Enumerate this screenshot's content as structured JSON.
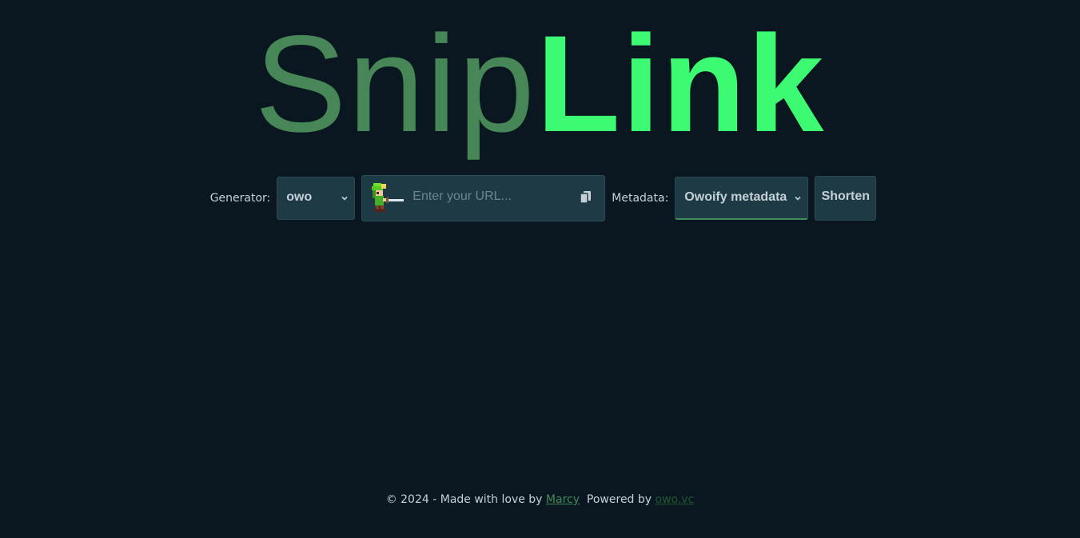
{
  "logo": {
    "part1": "Snip",
    "part2": "Link"
  },
  "generator": {
    "label": "Generator:",
    "value": "owo"
  },
  "url": {
    "placeholder": "Enter your URL..."
  },
  "metadata": {
    "label": "Metadata:",
    "value": "Owoify metadata"
  },
  "shorten_label": "Shorten",
  "footer": {
    "prefix": "© 2024 - Made with love by ",
    "author": "Marcy",
    "powered": "Powered by ",
    "service": "owo.vc"
  },
  "icons": {
    "generator_chevron": "chevron-down-icon",
    "metadata_chevron": "chevron-down-icon",
    "paste": "clipboard-paste-icon",
    "mascot": "pixel-swordsman-icon"
  },
  "colors": {
    "background": "#0a1720",
    "logo_snip": "#478757",
    "logo_link": "#3cfb73",
    "control_bg": "#1e3b45",
    "accent": "#3f8b59"
  }
}
